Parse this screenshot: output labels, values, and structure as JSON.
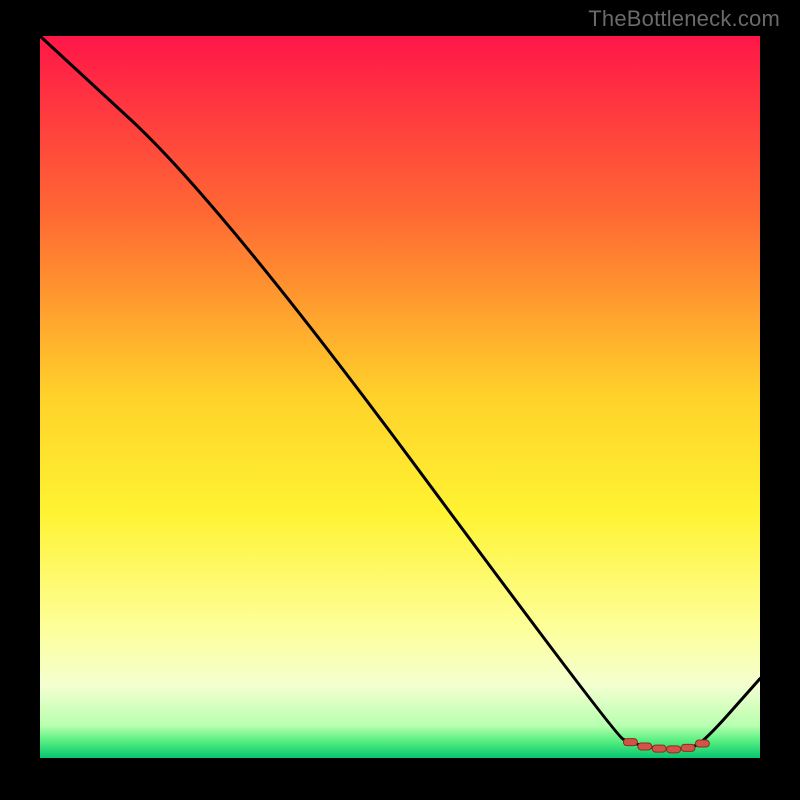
{
  "attribution": "TheBottleneck.com",
  "colors": {
    "gradient_stops": [
      {
        "offset": 0,
        "color": "#ff1648"
      },
      {
        "offset": 0.25,
        "color": "#ff6a33"
      },
      {
        "offset": 0.5,
        "color": "#ffd22a"
      },
      {
        "offset": 0.66,
        "color": "#fff332"
      },
      {
        "offset": 0.82,
        "color": "#fdff9a"
      },
      {
        "offset": 0.9,
        "color": "#f4ffd0"
      },
      {
        "offset": 0.955,
        "color": "#b8ffb0"
      },
      {
        "offset": 0.975,
        "color": "#5cf082"
      },
      {
        "offset": 1.0,
        "color": "#06c66e"
      }
    ],
    "curve": "#000000",
    "marker_fill": "#d35447",
    "marker_stroke": "#8a2d23"
  },
  "chart_data": {
    "type": "line",
    "title": "",
    "xlabel": "",
    "ylabel": "",
    "xlim": [
      0,
      100
    ],
    "ylim": [
      0,
      100
    ],
    "x": [
      0,
      25,
      80,
      82,
      84,
      86,
      88,
      90,
      92,
      100
    ],
    "values": [
      100,
      77,
      3,
      2.2,
      1.6,
      1.3,
      1.2,
      1.4,
      2.0,
      11
    ],
    "marker_indices": [
      3,
      4,
      5,
      6,
      7,
      8
    ]
  }
}
